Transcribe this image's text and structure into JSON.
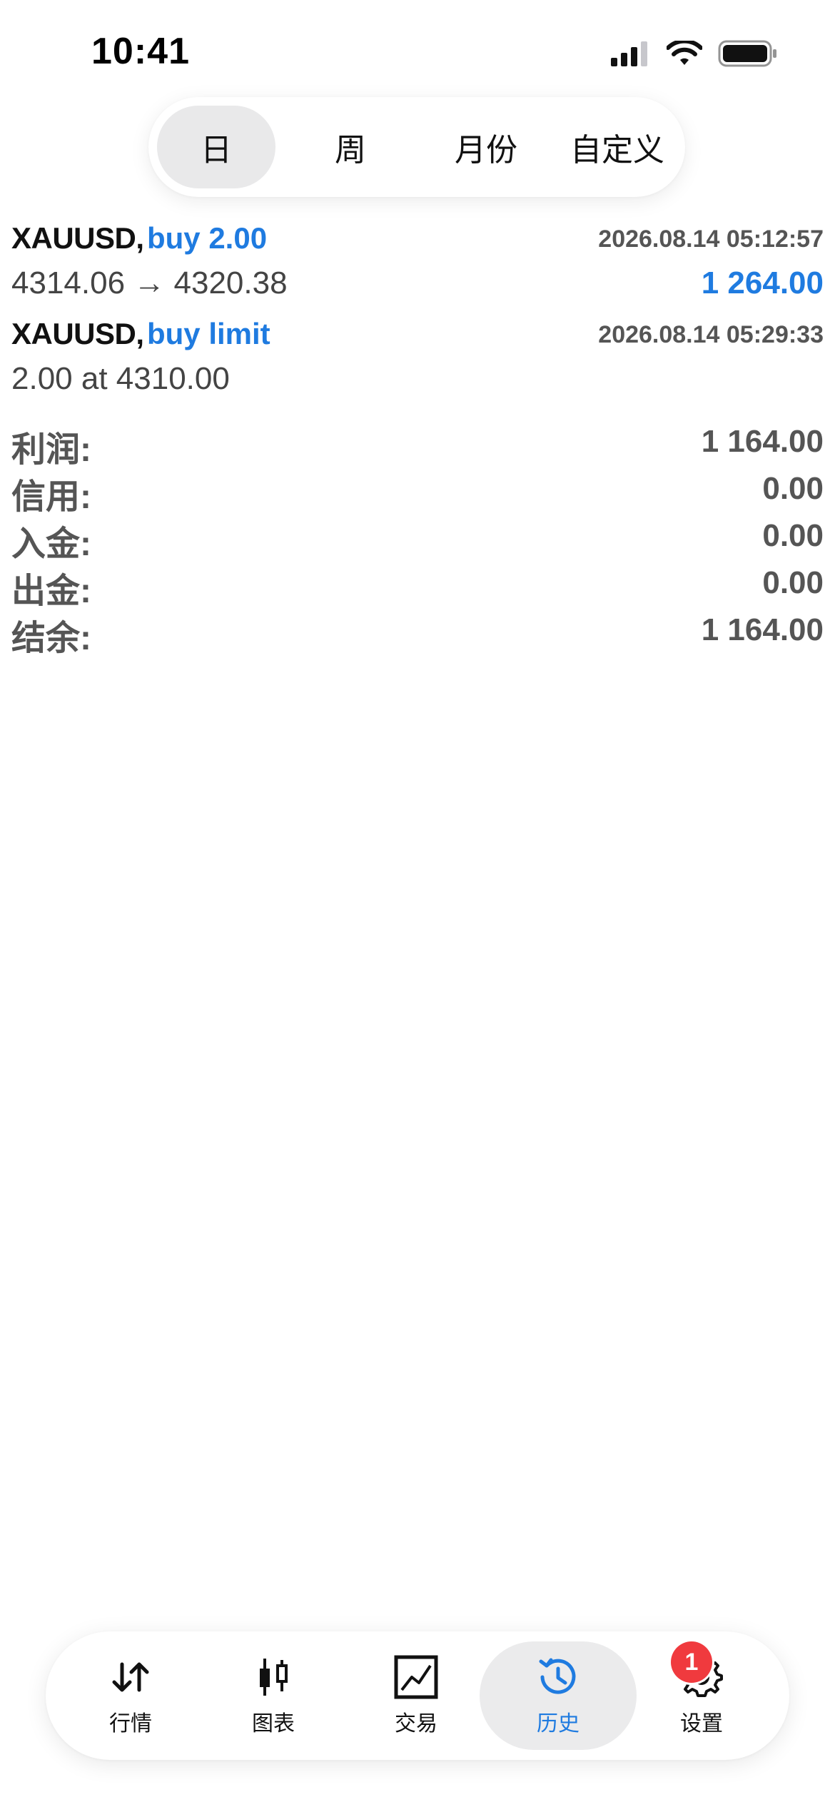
{
  "status_bar": {
    "time": "10:41"
  },
  "period_tabs": [
    {
      "label": "日",
      "active": true
    },
    {
      "label": "周",
      "active": false
    },
    {
      "label": "月份",
      "active": false
    },
    {
      "label": "自定义",
      "active": false
    }
  ],
  "trades": [
    {
      "symbol": "XAUUSD,",
      "type": "buy 2.00",
      "timestamp": "2026.08.14 05:12:57",
      "detail": "4314.06 → 4320.38",
      "profit": "1 264.00"
    },
    {
      "symbol": "XAUUSD,",
      "type": "buy limit",
      "timestamp": "2026.08.14 05:29:33",
      "detail": "2.00 at 4310.00",
      "profit": ""
    }
  ],
  "summary": [
    {
      "label": "利润:",
      "value": "1 164.00"
    },
    {
      "label": "信用:",
      "value": "0.00"
    },
    {
      "label": "入金:",
      "value": "0.00"
    },
    {
      "label": "出金:",
      "value": "0.00"
    },
    {
      "label": "结余:",
      "value": "1 164.00"
    }
  ],
  "bottom_tabs": [
    {
      "label": "行情",
      "icon": "quotes-arrows-icon",
      "active": false
    },
    {
      "label": "图表",
      "icon": "candlestick-chart-icon",
      "active": false
    },
    {
      "label": "交易",
      "icon": "trade-line-chart-icon",
      "active": false
    },
    {
      "label": "历史",
      "icon": "history-clock-icon",
      "active": true
    },
    {
      "label": "设置",
      "icon": "gear-icon",
      "active": false
    }
  ],
  "settings_badge": "1",
  "colors": {
    "accent": "#1f7be0",
    "badge": "#f03a3e",
    "muted": "#555555"
  }
}
